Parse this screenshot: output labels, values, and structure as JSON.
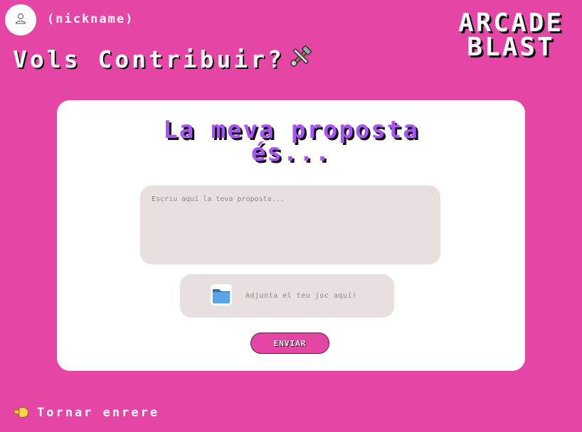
{
  "header": {
    "nickname": "(nickname)",
    "title": "Vols Contribuir?",
    "title_icon": "hammer-and-wrench-icon",
    "user_icon": "user-icon"
  },
  "logo": {
    "line1": "ARCADE",
    "line2": "BLAST"
  },
  "form": {
    "heading_line1": "La meva proposta",
    "heading_line2": "és...",
    "proposal_placeholder": "Escriu aquí la teva proposta...",
    "attach_label": "Adjunta el teu joc aquí!",
    "attach_icon": "folder-icon",
    "submit_label": "ENVIAR"
  },
  "footer": {
    "back_label": "Tornar enrere",
    "back_icon": "pointing-hand-icon"
  },
  "colors": {
    "background": "#e545a4",
    "heading": "#a855f7",
    "field_bg": "#e8e0df"
  }
}
